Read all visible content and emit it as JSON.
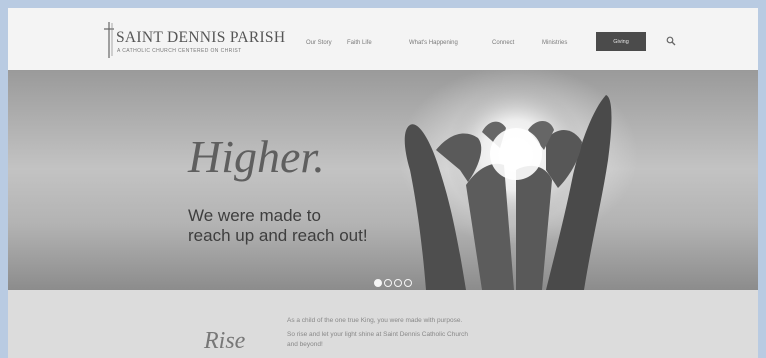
{
  "logo": {
    "title": "SAINT DENNIS PARISH",
    "subtitle": "A CATHOLIC CHURCH CENTERED ON CHRIST"
  },
  "nav": {
    "items": [
      "Our Story",
      "Faith Life",
      "What's Happening",
      "Connect",
      "Ministries"
    ],
    "giving_label": "Giving",
    "search_icon": "search-icon"
  },
  "hero": {
    "title": "Higher.",
    "subtitle_line1": "We were made to",
    "subtitle_line2": "reach up and reach out!",
    "slides_total": 4,
    "active_slide": 1
  },
  "intro": {
    "word": "Rise",
    "line1": "As a child of the one true King, you were made with purpose.",
    "line2": "So rise and let your light shine at Saint Dennis Catholic Church",
    "line3": "and beyond!"
  },
  "colors": {
    "page_bg": "#b9cbe2",
    "giving_bg": "#4b4b4b",
    "intro_bg": "#dcdcdc"
  }
}
